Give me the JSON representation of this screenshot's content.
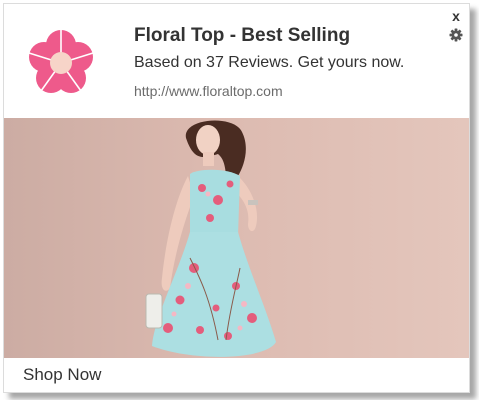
{
  "notification": {
    "title": "Floral Top - Best Selling",
    "subtitle": "Based on 37 Reviews. Get yours now.",
    "url": "http://www.floraltop.com",
    "close_label": "x",
    "cta_label": "Shop Now"
  },
  "icons": {
    "logo": "flower-logo-icon",
    "close": "close-icon",
    "settings": "gear-icon"
  },
  "image": {
    "subject": "woman-in-floral-embroidered-blue-dress"
  },
  "colors": {
    "logo_petal": "#ee5a8b",
    "logo_center": "#f7d4c8",
    "background_photo": "#d9b7ad",
    "dress": "#9fd9dc",
    "text_primary": "#333333",
    "text_secondary": "#6b6b6b"
  }
}
